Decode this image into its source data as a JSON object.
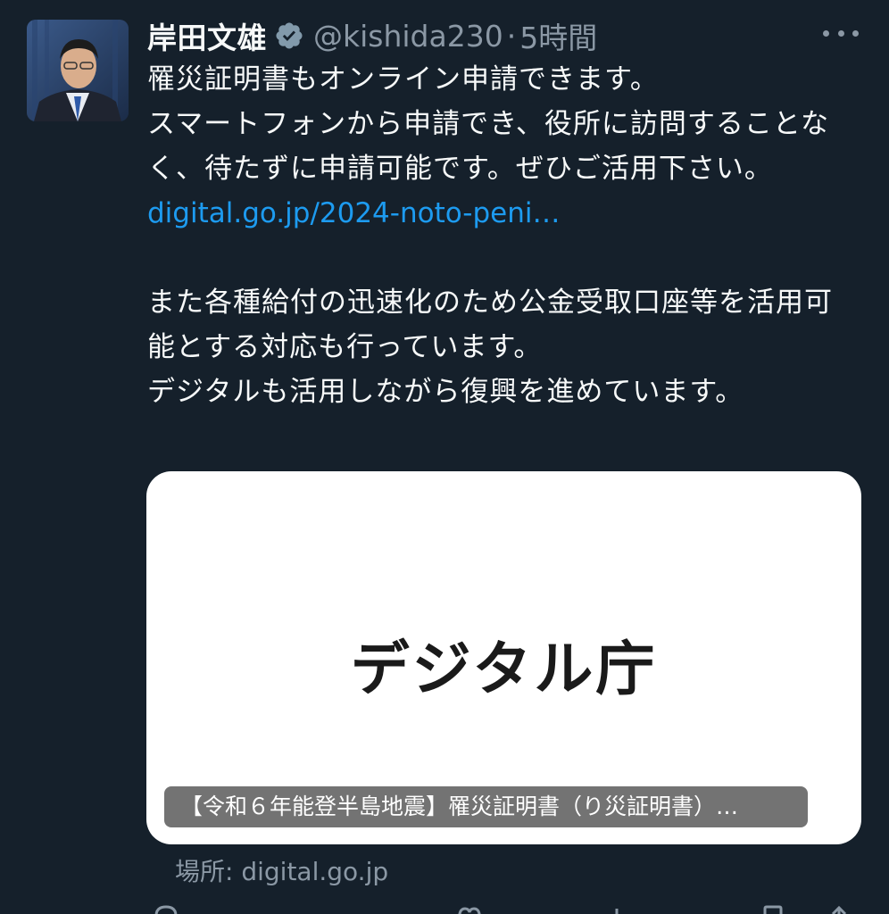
{
  "author": {
    "display_name": "岸田文雄",
    "handle": "@kishida230",
    "separator": "·",
    "time": "5時間"
  },
  "tweet": {
    "lines": [
      "罹災証明書もオンライン申請できます。",
      "スマートフォンから申請でき、役所に訪問することなく、待たずに申請可能です。ぜひご活用下さい。"
    ],
    "link": "digital.go.jp/2024-noto-peni…",
    "lines2": [
      "また各種給付の迅速化のため公金受取口座等を活用可能とする対応も行っています。",
      "デジタルも活用しながら復興を進めています。"
    ]
  },
  "card": {
    "logo_text": "デジタル庁",
    "caption": "【令和６年能登半島地震】罹災証明書（り災証明書）…"
  },
  "source": "場所: digital.go.jp",
  "icons": {
    "verified": "verified-badge-icon",
    "more": "more-options-icon",
    "reply": "reply-icon",
    "retweet": "retweet-icon",
    "like": "like-icon",
    "views": "views-icon",
    "bookmark": "bookmark-icon",
    "share": "share-icon"
  },
  "colors": {
    "background": "#15202b",
    "link": "#1d9bf0",
    "secondary_text": "#8b98a5",
    "verified_badge": "#829aab"
  }
}
